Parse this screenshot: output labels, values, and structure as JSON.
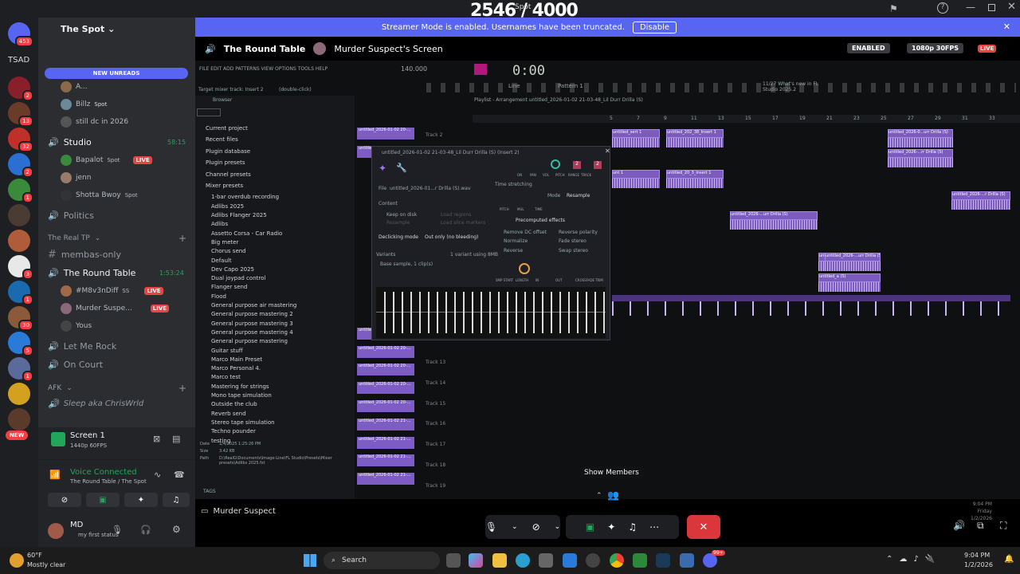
{
  "viewer_counter": "2546 / 4000",
  "viewer_counter_sub": "Spot",
  "streamer_banner": {
    "text": "Streamer Mode is enabled. Usernames have been truncated.",
    "button": "Disable"
  },
  "server": {
    "name": "The Spot",
    "tsad": "TSAD",
    "new_unreads": "NEW UNREADS",
    "new_badge": "NEW",
    "home_badge": "453"
  },
  "server_badges": [
    "2",
    "13",
    "32",
    "2",
    "1",
    "3",
    "1",
    "30",
    "5",
    "1",
    "1"
  ],
  "channels": {
    "truncated_user": "A...",
    "billz": "Billz",
    "billz_tag": "Spot",
    "still_dc": "still dc in 2026",
    "studio": "Studio",
    "studio_time": "58:15",
    "bapalot": "Bapalot",
    "bapalot_tag": "Spot",
    "jenn": "jenn",
    "shotta": "Shotta Bwoy",
    "shotta_tag": "Spot",
    "politics": "Politics",
    "real_tp": "The Real TP",
    "membas": "membas-only",
    "round_table": "The Round Table",
    "round_time": "1:53:24",
    "m8v": "#M8v3nDiff",
    "m8v_tag": "SS",
    "murder": "Murder Suspe...",
    "yous": "Yous",
    "let_me_rock": "Let Me Rock",
    "on_court": "On Court",
    "afk": "AFK",
    "sleep": "Sleep aka ChrisWrld",
    "live": "LIVE"
  },
  "screen_panel": {
    "title": "Screen 1",
    "quality": "1440p 60FPS"
  },
  "voice": {
    "status": "Voice Connected",
    "location": "The Round Table / The Spot"
  },
  "user": {
    "name": "MD",
    "status": "my first status"
  },
  "stream_header": {
    "channel": "The Round Table",
    "screen": "Murder Suspect's Screen",
    "enabled": "ENABLED",
    "quality": "1080p 30FPS",
    "live": "LIVE"
  },
  "fl": {
    "menu": "FILE EDIT ADD PATTERNS VIEW OPTIONS TOOLS HELP",
    "target": "Target mixer track: Insert 2",
    "dbl": "(double-click)",
    "time": "0:00",
    "tempo": "140.000",
    "pattern": "Pattern 1",
    "line": "Line",
    "news": "11/27 What's new in FL Studio 2025.2",
    "browser_label": "Browser",
    "playlist_title": "Playlist - Arrangement  untitled_2026-01-02 21-03-48_Lil Durr Drilla (S)",
    "browser_items": [
      "Current project",
      "Recent files",
      "Plugin database",
      "Plugin presets",
      "Channel presets",
      "Mixer presets",
      "1-bar overdub recording",
      "Adlibs 2025",
      "Adlibs Flanger 2025",
      "Adlibs",
      "Assetto Corsa - Car Radio",
      "Big meter",
      "Chorus send",
      "Default",
      "Dev Capo 2025",
      "Dual joypad control",
      "Flanger send",
      "Flood",
      "General purpose air mastering",
      "General purpose mastering 2",
      "General purpose mastering 3",
      "General purpose mastering 4",
      "General purpose mastering",
      "Guitar stuff",
      "Marco Main Preset",
      "Marco Personal 4.",
      "Marco test",
      "Mastering for strings",
      "Mono tape simulation",
      "Outside the club",
      "Reverb send",
      "Stereo tape simulation",
      "Techno pounder",
      "testing"
    ],
    "info": {
      "date_label": "Date",
      "date": "1/4/2025 1:25:26 PM",
      "size_label": "Size",
      "size": "3.42 KB",
      "path_label": "Path",
      "path": "D:\\RealG\\Documents\\Image-Line\\FL Studio\\Presets\\Mixer presets\\Adlibs 2025.fst"
    },
    "tags": "TAGS",
    "sample_window": {
      "title": "untitled_2026-01-02 21-03-48_Lil Durr Drilla (S) (Insert 2)",
      "file_label": "File",
      "file": "untitled_2026-01...r Drilla (S).wav",
      "time_stretching": "Time stretching",
      "mode": "Mode",
      "mode_value": "Resample",
      "content": "Content",
      "keep_on_disk": "Keep on disk",
      "resample": "Resample",
      "load_regions": "Load regions",
      "load_slice": "Load slice markers",
      "precomputed": "Precomputed effects",
      "remove_dc": "Remove DC offset",
      "normalize": "Normalize",
      "reverse": "Reverse",
      "reverse_pol": "Reverse polarity",
      "fade_stereo": "Fade stereo",
      "swap_stereo": "Swap stereo",
      "declicking": "Declicking mode",
      "declick_value": "Out only (no bleeding)",
      "variants": "Variants",
      "variants_value": "1 variant using 8MB",
      "base_sample": "Base sample, 1 clip(s)",
      "knob_labels": [
        "SMP START",
        "LENGTH",
        "IN",
        "OUT",
        "CROSSFADE",
        "TRIM"
      ],
      "top_labels": [
        "PITCH",
        "MUL",
        "TIME"
      ],
      "ch_labels": [
        "ON",
        "PAN",
        "VOL",
        "PITCH",
        "RANGE",
        "TRACK"
      ],
      "num1": "2",
      "num2": "2"
    },
    "tracks": [
      "Track 2",
      "Track 13",
      "Track 14",
      "Track 15",
      "Track 16",
      "Track 17",
      "Track 18",
      "Track 19"
    ],
    "clip_name": "untitled_2026-01-02 20-...",
    "clip_name2": "untitled_2026-01-02 21-...",
    "playlist_clips": [
      "untitled_sert 1",
      "untitled_202_38_Insert 1",
      "untitled_2026-0...urr Drilla (S)",
      "untitled_2026-...rr Drilla (S)",
      "unt 1",
      "untitled_20_3_Insert 1",
      "untitled_2026-...r Drilla (S)",
      "untitled_2026-...urr Drilla (S)",
      "untitled_2026-...urr Drilla (S)",
      "untitled_a (S)",
      "untitled_2026-...urr Drilla (S)",
      "untitled_2026-...rr Drilla (S)"
    ],
    "ruler": [
      "5",
      "7",
      "9",
      "11",
      "13",
      "15",
      "17",
      "19",
      "21",
      "23",
      "25",
      "27",
      "29",
      "31",
      "33"
    ],
    "clock": {
      "time": "9:04 PM",
      "day": "Friday",
      "date": "1/2/2026"
    }
  },
  "tooltip": "Show Members",
  "stream_user": "Murder Suspect",
  "taskbar": {
    "weather_temp": "60°F",
    "weather": "Mostly clear",
    "search": "Search",
    "time": "9:04 PM",
    "date": "1/2/2026",
    "notif": "99+"
  }
}
